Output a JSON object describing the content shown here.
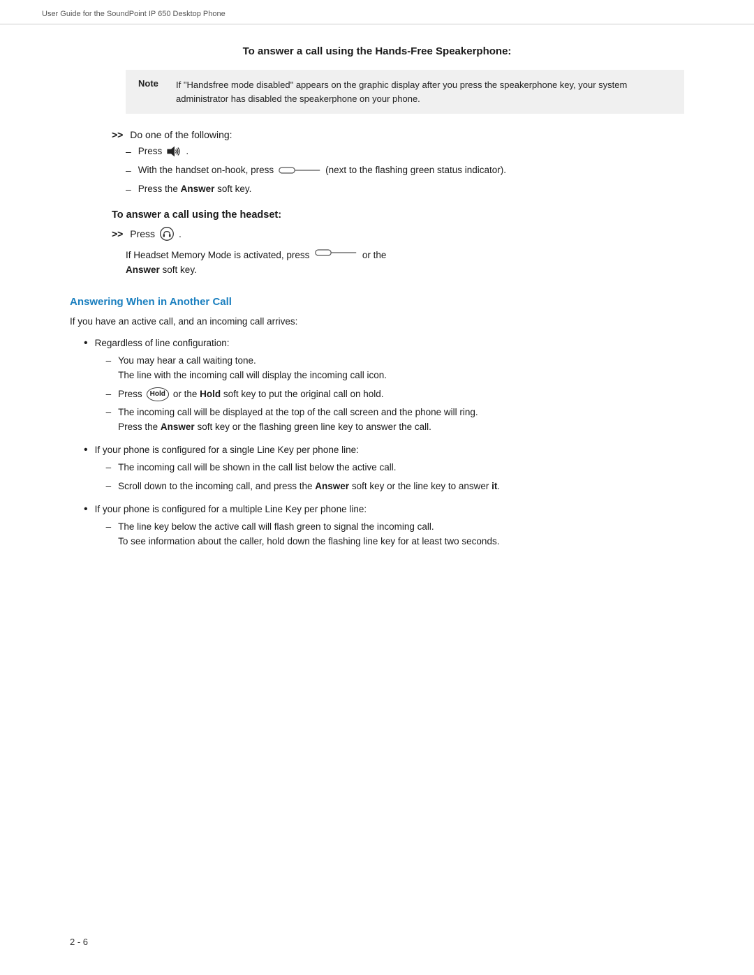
{
  "header": {
    "text": "User Guide for the SoundPoint IP 650 Desktop Phone"
  },
  "page_number": "2 - 6",
  "main": {
    "speakerphone_section": {
      "heading": "To answer a call using the Hands-Free Speakerphone:",
      "note_label": "Note",
      "note_text": "If \"Handsfree mode disabled\" appears on the graphic display after you press the speakerphone key, your system administrator has disabled the speakerphone on your phone.",
      "do_one": "Do one of the following:",
      "items": [
        {
          "type": "speaker_press",
          "text_before": "Press",
          "text_after": "."
        },
        {
          "type": "handset_press",
          "text": "With the handset on-hook, press",
          "text_after": "(next to the flashing green status indicator)."
        },
        {
          "type": "text",
          "text_before": "Press the ",
          "bold": "Answer",
          "text_after": " soft key."
        }
      ]
    },
    "headset_section": {
      "heading": "To answer a call using the headset:",
      "press_label": "Press",
      "press_after": " .",
      "memory_mode": "If Headset Memory Mode is activated, press",
      "memory_after": "or the",
      "answer_bold": "Answer",
      "answer_end": "soft key."
    },
    "answering_section": {
      "heading": "Answering When in Another Call",
      "intro": "If you have an active call, and an incoming call arrives:",
      "bullets": [
        {
          "label": "Regardless of line configuration:",
          "sub": [
            {
              "text": "You may hear a call waiting tone.\nThe line with the incoming call will display the incoming call icon."
            },
            {
              "text_before": "Press ",
              "hold_label": "Hold",
              "text_after": " or the ",
              "bold": "Hold",
              "text_end": " soft key to put the original call on hold."
            },
            {
              "text": "The incoming call will be displayed at the top of the call screen and the phone will ring.\nPress the Answer soft key or the flashing green line key to answer the call.",
              "bold_word": "Answer"
            }
          ]
        },
        {
          "label": "If your phone is configured for a single Line Key per phone line:",
          "sub": [
            {
              "text": "The incoming call will be shown in the call list below the active call."
            },
            {
              "text": "Scroll down to the incoming call, and press the Answer soft key or the line key to answer it.",
              "bold_word": "Answer"
            }
          ]
        },
        {
          "label": "If your phone is configured for a multiple Line Key per phone line:",
          "sub": [
            {
              "text": "The line key below the active call will flash green to signal the incoming call.\nTo see information about the caller, hold down the flashing line key for at least two seconds."
            }
          ]
        }
      ]
    }
  }
}
